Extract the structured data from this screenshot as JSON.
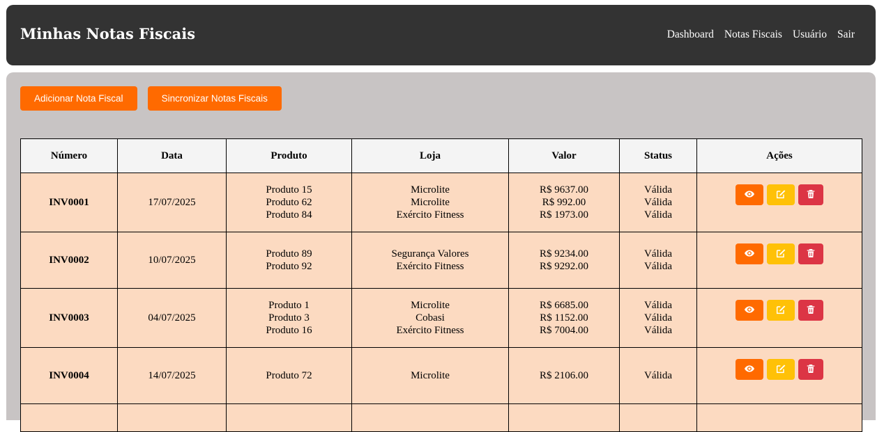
{
  "header": {
    "title": "Minhas Notas Fiscais",
    "nav": [
      "Dashboard",
      "Notas Fiscais",
      "Usuário",
      "Sair"
    ]
  },
  "toolbar": {
    "add_label": "Adicionar Nota Fiscal",
    "sync_label": "Sincronizar Notas Fiscais"
  },
  "table": {
    "columns": [
      "Número",
      "Data",
      "Produto",
      "Loja",
      "Valor",
      "Status",
      "Ações"
    ],
    "rows": [
      {
        "numero": "INV0001",
        "data": "17/07/2025",
        "produtos": [
          "Produto 15",
          "Produto 62",
          "Produto 84"
        ],
        "lojas": [
          "Microlite",
          "Microlite",
          "Exército Fitness"
        ],
        "valores": [
          "R$ 9637.00",
          "R$ 992.00",
          "R$ 1973.00"
        ],
        "status": [
          "Válida",
          "Válida",
          "Válida"
        ]
      },
      {
        "numero": "INV0002",
        "data": "10/07/2025",
        "produtos": [
          "Produto 89",
          "Produto 92"
        ],
        "lojas": [
          "Segurança Valores",
          "Exército Fitness"
        ],
        "valores": [
          "R$ 9234.00",
          "R$ 9292.00"
        ],
        "status": [
          "Válida",
          "Válida"
        ]
      },
      {
        "numero": "INV0003",
        "data": "04/07/2025",
        "produtos": [
          "Produto 1",
          "Produto 3",
          "Produto 16"
        ],
        "lojas": [
          "Microlite",
          "Cobasi",
          "Exército Fitness"
        ],
        "valores": [
          "R$ 6685.00",
          "R$ 1152.00",
          "R$ 7004.00"
        ],
        "status": [
          "Válida",
          "Válida",
          "Válida"
        ]
      },
      {
        "numero": "INV0004",
        "data": "14/07/2025",
        "produtos": [
          "Produto 72"
        ],
        "lojas": [
          "Microlite"
        ],
        "valores": [
          "R$ 2106.00"
        ],
        "status": [
          "Válida"
        ]
      }
    ]
  },
  "icons": {
    "view": "eye-icon",
    "edit": "edit-icon",
    "delete": "trash-icon"
  },
  "colors": {
    "header_bg": "#333333",
    "content_bg": "#c8c4c4",
    "accent": "#ff6a00",
    "row_bg": "#fcdac1",
    "edit": "#ffc107",
    "delete": "#dc3545"
  }
}
